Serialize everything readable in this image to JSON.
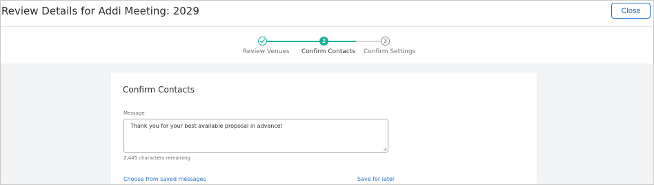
{
  "header": {
    "title": "Review Details for Addi Meeting: 2029",
    "close_label": "Close"
  },
  "stepper": {
    "steps": [
      {
        "number": "",
        "label": "Review Venues",
        "state": "complete",
        "icon": "check-icon"
      },
      {
        "number": "2",
        "label": "Confirm Contacts",
        "state": "active"
      },
      {
        "number": "3",
        "label": "Confirm Settings",
        "state": "pending"
      }
    ]
  },
  "card": {
    "title": "Confirm Contacts",
    "message_label": "Message",
    "message_value": "Thank you for your best available proposal in advance!",
    "char_count": "2,445 characters remaining",
    "choose_saved_label": "Choose from saved messages",
    "save_later_label": "Save for later"
  },
  "colors": {
    "accent": "#17b39a",
    "link": "#1f6fc4",
    "background": "#f2f3f5"
  }
}
